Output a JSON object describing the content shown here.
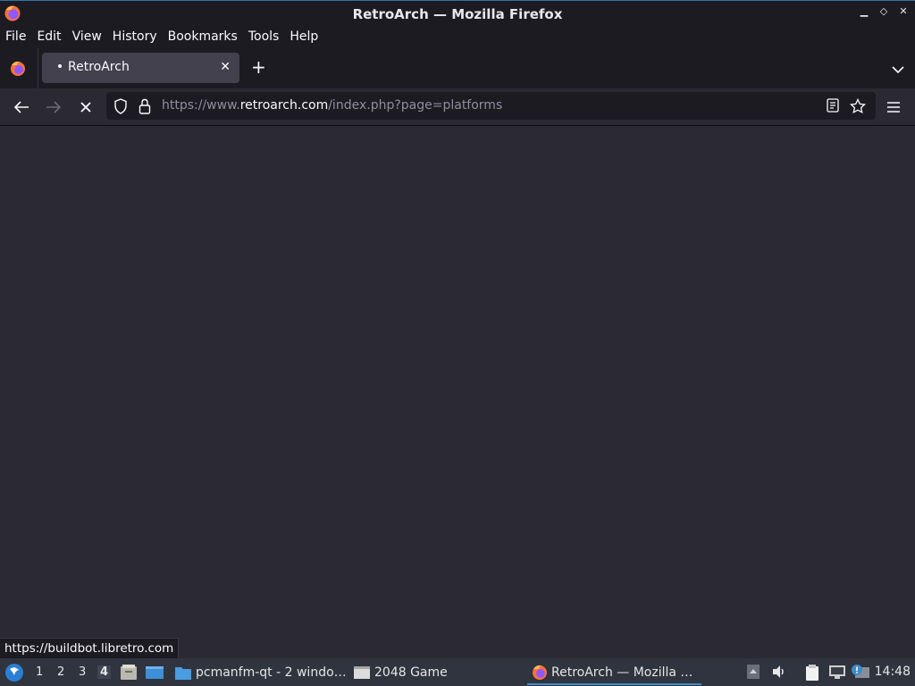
{
  "window": {
    "title": "RetroArch — Mozilla Firefox"
  },
  "menu": {
    "items": [
      "File",
      "Edit",
      "View",
      "History",
      "Bookmarks",
      "Tools",
      "Help"
    ]
  },
  "tabs": [
    {
      "label": "RetroArch",
      "loading": true
    }
  ],
  "urlbar": {
    "url_prefix": "https://www.",
    "url_host": "retroarch.com",
    "url_path": "/index.php?page=platforms"
  },
  "status": {
    "text": "https://buildbot.libretro.com"
  },
  "taskbar": {
    "desktops": [
      "1",
      "2",
      "3",
      "4"
    ],
    "active_desktop": "4",
    "tasks": [
      {
        "label": "pcmanfm-qt - 2 windo…",
        "icon": "folder-icon"
      },
      {
        "label": "2048 Game",
        "icon": "window-icon"
      },
      {
        "label": "RetroArch — Mozilla …",
        "icon": "firefox-icon",
        "active": true
      }
    ],
    "clock": "14:48"
  },
  "colors": {
    "chrome": "#1c1b22",
    "content": "#2b2a33",
    "tab_active": "#42414d",
    "taskbar": "#2f343f",
    "accent": "#3f8bc7"
  }
}
